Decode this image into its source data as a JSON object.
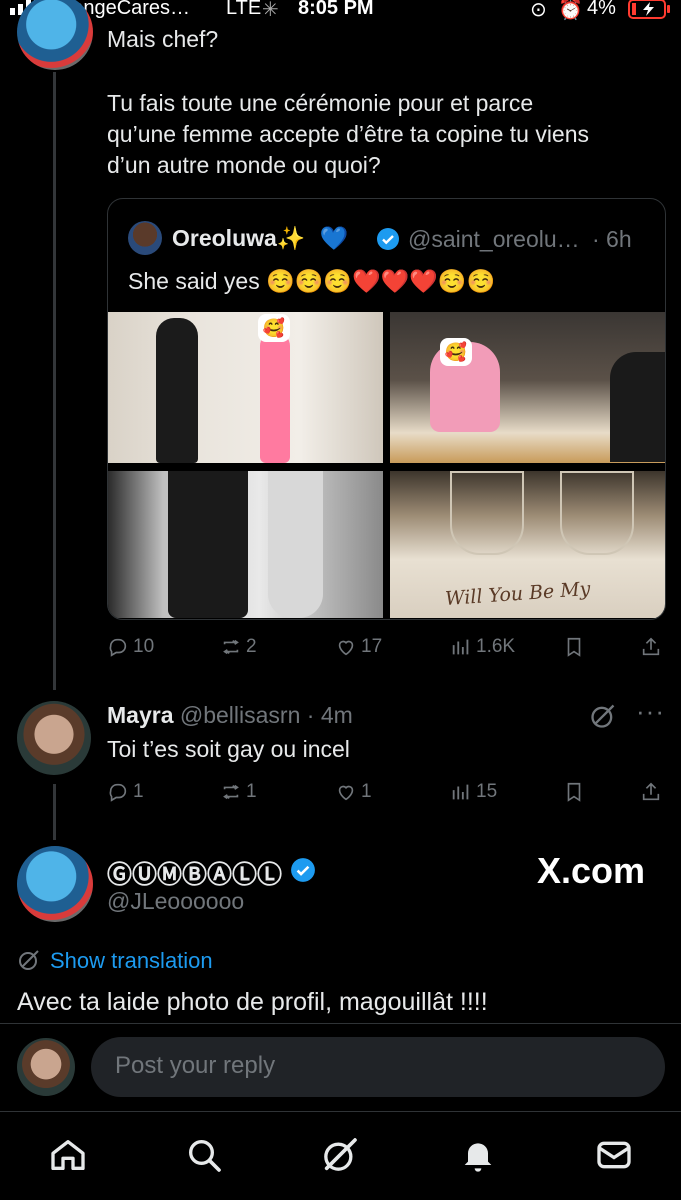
{
  "status_bar": {
    "carrier": "OrangeCares…",
    "network": "LTE",
    "time": "8:05 PM",
    "battery": "4%"
  },
  "tweet_top": {
    "text_line1": "Mais chef?",
    "text_line2": "Tu fais toute une cérémonie pour et parce",
    "text_line3": "qu’une femme accepte d’être ta copine tu viens",
    "text_line4": "d’un autre monde ou quoi?",
    "quote": {
      "name": "Oreoluwa✨",
      "heart": "💙",
      "handle": "@saint_oreolu…",
      "time": "· 6h",
      "text": "She said yes ☺️☺️☺️❤️❤️❤️☺️☺️",
      "photo_caption": "Will You Be My"
    },
    "actions": {
      "replies": "10",
      "reposts": "2",
      "likes": "17",
      "views": "1.6K"
    }
  },
  "tweet_reply": {
    "name": "Mayra",
    "handle": "@bellisasrn",
    "time": "· 4m",
    "text": "Toi t’es soit gay ou incel",
    "actions": {
      "replies": "1",
      "reposts": "1",
      "likes": "1",
      "views": "15"
    }
  },
  "main_tweet": {
    "name": "ⒼⓊⓂⒷⒶⓁⓁ",
    "handle": "@JLeoooooo",
    "watermark": "X.com",
    "translate_label": "Show translation",
    "text": "Avec ta laide photo de profil, magouillât !!!!"
  },
  "reply_box": {
    "placeholder": "Post your reply"
  },
  "colors": {
    "accent": "#1d9bf0",
    "muted": "#71767b",
    "background": "#000000"
  },
  "tab_bar": [
    "home-icon",
    "search-icon",
    "grok-icon",
    "notifications-icon",
    "messages-icon"
  ]
}
